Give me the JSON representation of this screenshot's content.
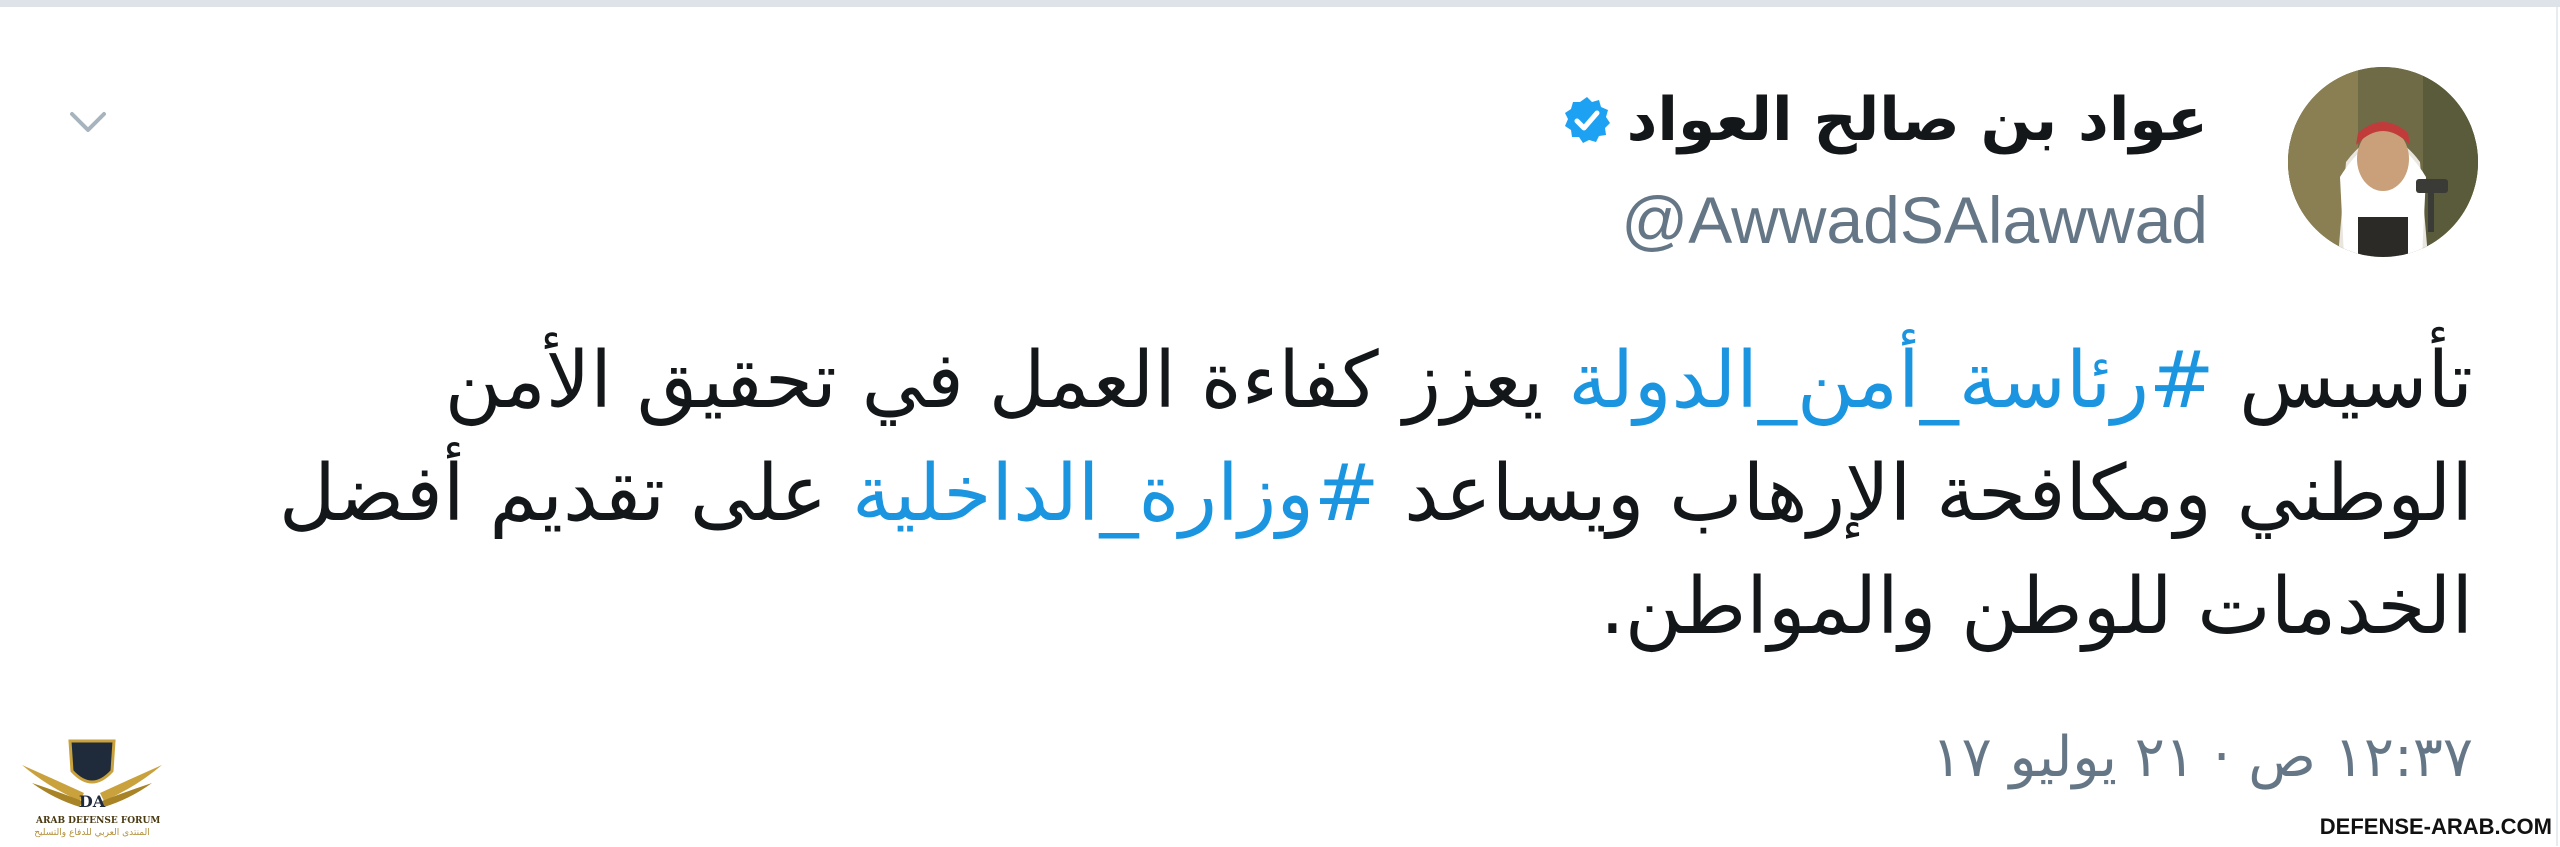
{
  "tweet": {
    "author": {
      "display_name": "عواد بن صالح العواد",
      "handle": "@AwwadSAlawwad",
      "verified": true,
      "verified_color": "#1da1f2"
    },
    "text_parts": [
      "تأسيس ",
      "#رئاسة_أمن_الدولة",
      " يعزز كفاءة العمل في تحقيق الأمن الوطني ومكافحة الإرهاب ويساعد ",
      "#وزارة_الداخلية",
      " على تقديم أفضل الخدمات للوطن والمواطن."
    ],
    "timestamp": "١٢:٣٧ ص · ٢١ يوليو ١٧",
    "menu_icon": "chevron-down-icon",
    "hashtag_color": "#1b95e0"
  },
  "watermark": {
    "forum_name": "ARAB DEFENSE FORUM",
    "forum_name_arabic": "المنتدى العربي للدفاع والتسليح",
    "logo_text": "DA",
    "site": "DEFENSE-ARAB.COM"
  }
}
